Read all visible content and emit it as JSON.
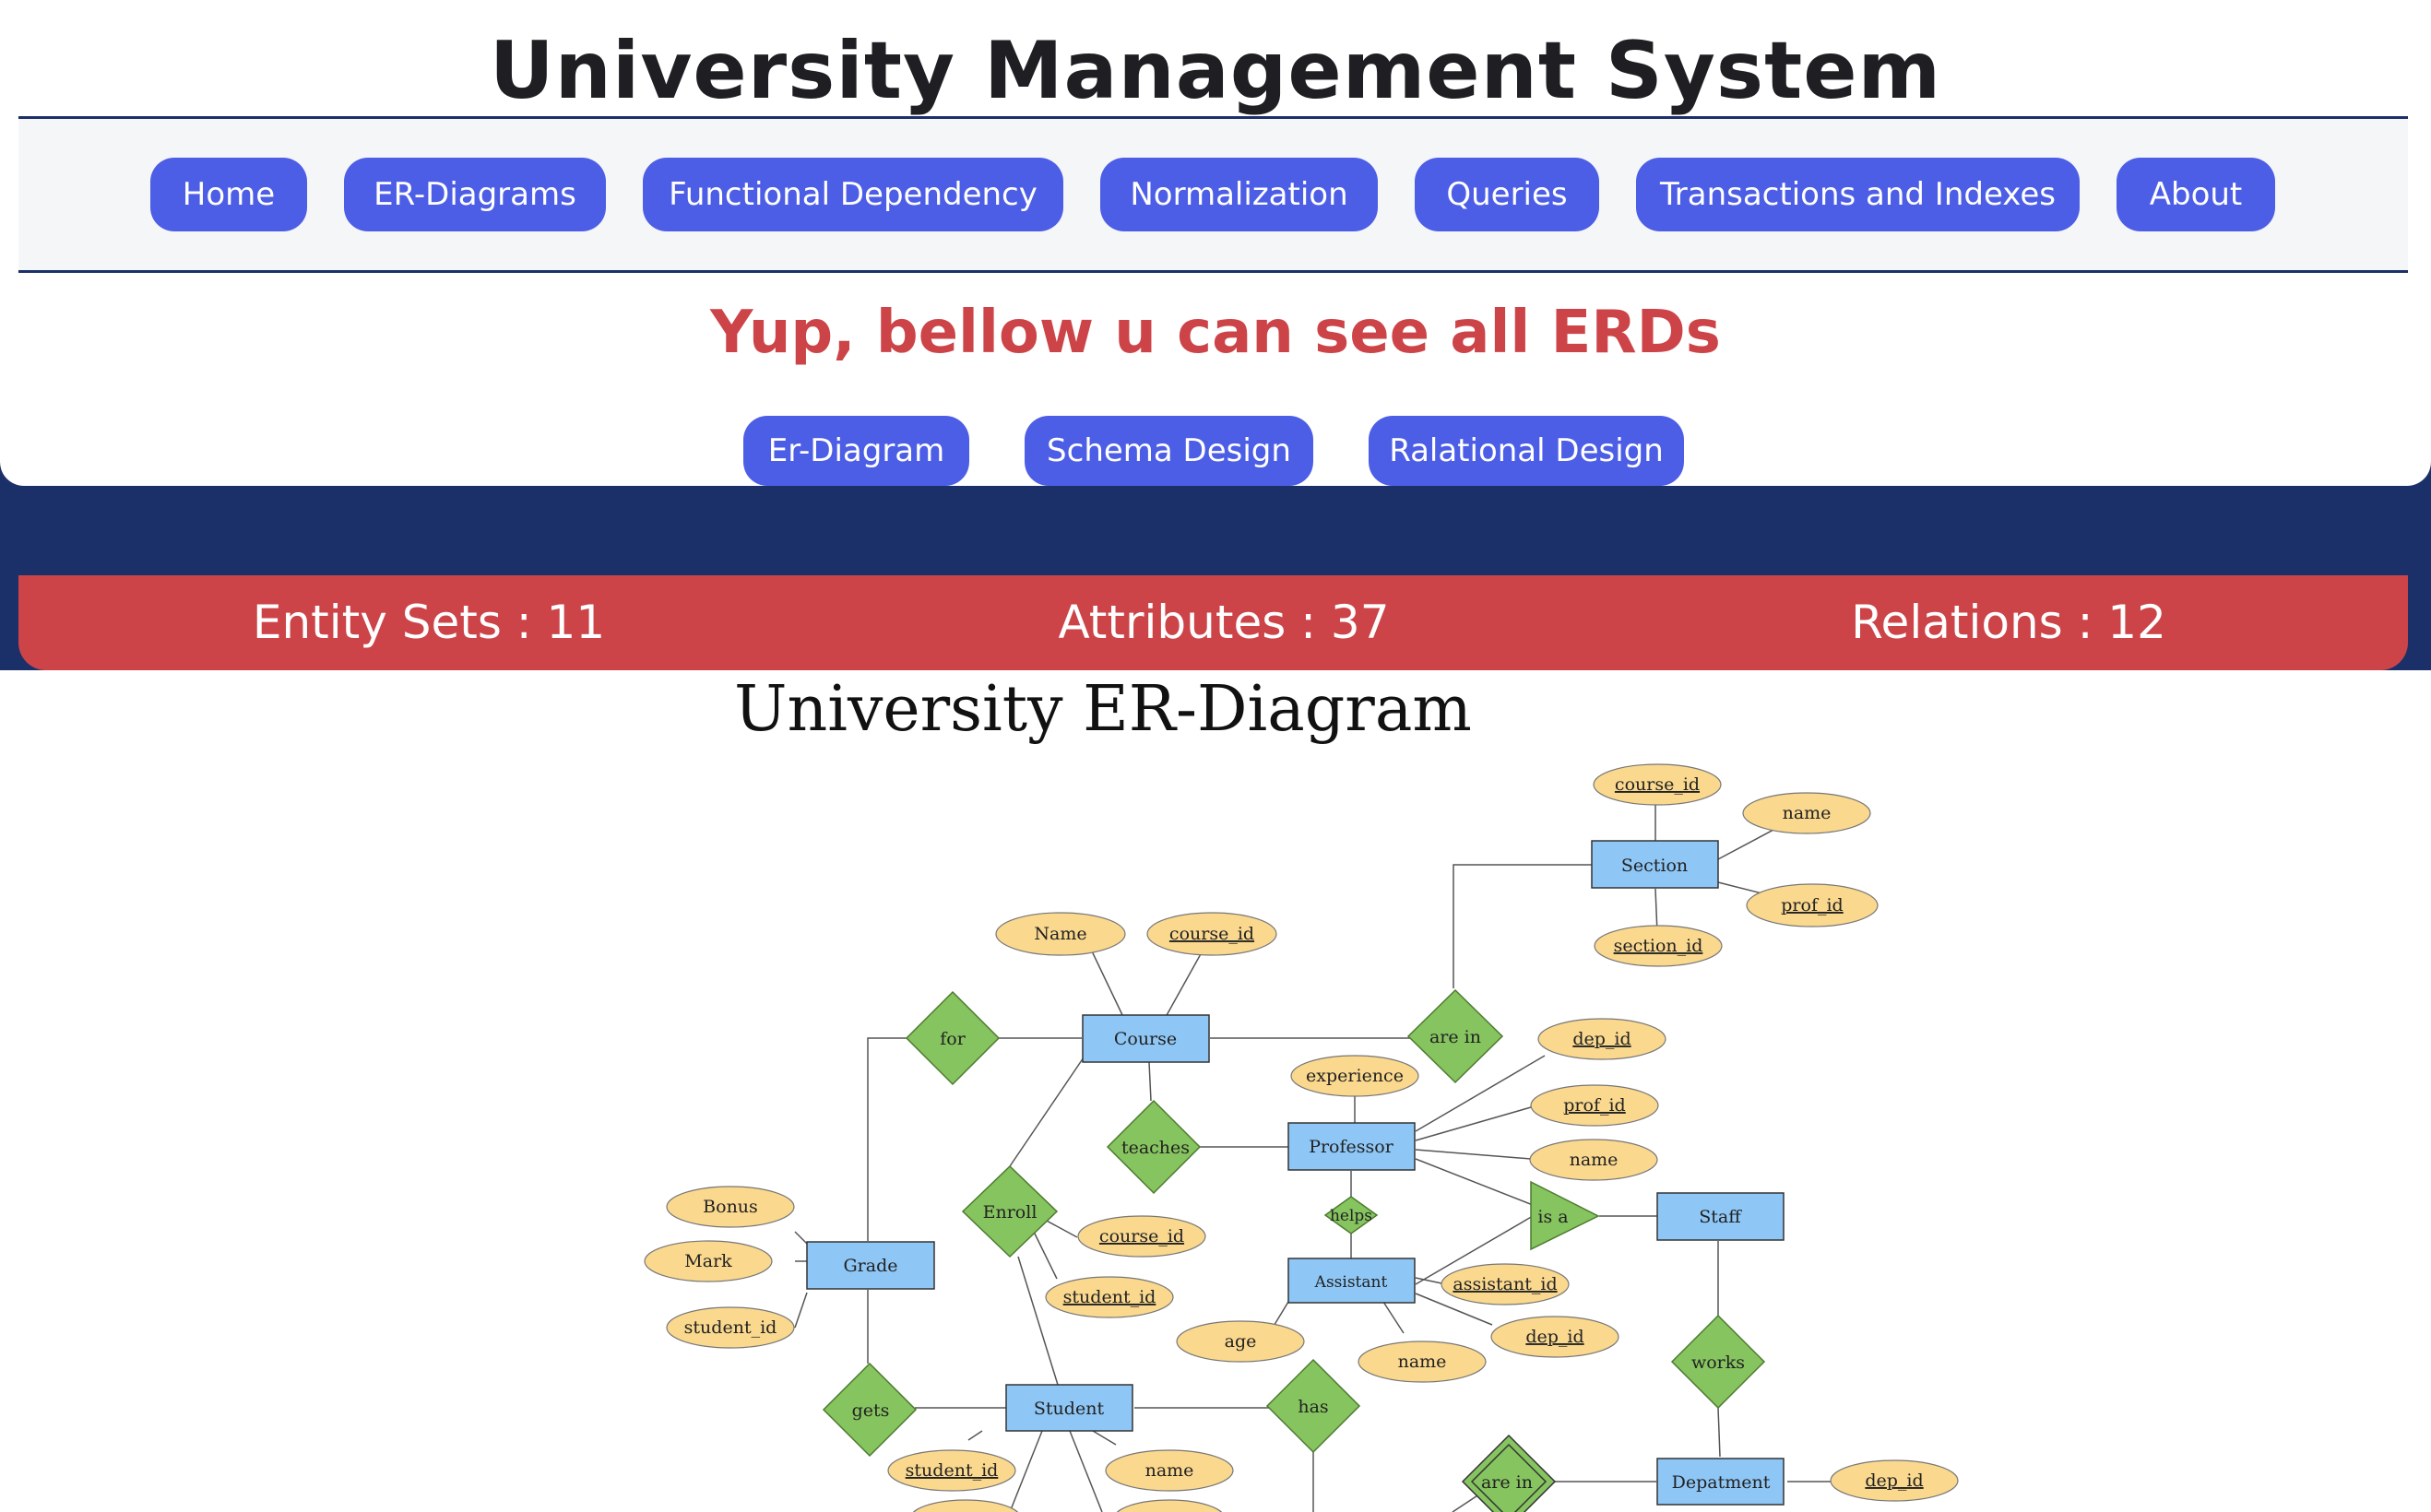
{
  "header": {
    "title": "University Management System"
  },
  "nav": {
    "items": [
      {
        "label": "Home",
        "name": "nav-home"
      },
      {
        "label": "ER-Diagrams",
        "name": "nav-er-diagrams"
      },
      {
        "label": "Functional Dependency",
        "name": "nav-functional-dependency"
      },
      {
        "label": "Normalization",
        "name": "nav-normalization"
      },
      {
        "label": "Queries",
        "name": "nav-queries"
      },
      {
        "label": "Transactions and Indexes",
        "name": "nav-transactions-indexes"
      },
      {
        "label": "About",
        "name": "nav-about"
      }
    ]
  },
  "subtitle": "Yup, bellow u can see all ERDs",
  "subnav": {
    "items": [
      {
        "label": "Er-Diagram",
        "name": "subnav-er-diagram"
      },
      {
        "label": "Schema Design",
        "name": "subnav-schema-design"
      },
      {
        "label": "Ralational Design",
        "name": "subnav-relational-design"
      }
    ]
  },
  "stats": {
    "entity_sets": "Entity Sets : 11",
    "attributes": "Attributes : 37",
    "relations": "Relations : 12"
  },
  "colors": {
    "accent": "#4d5ee6",
    "brand_dark": "#1b3068",
    "red": "#cc4448",
    "entity": "#8ec6f5",
    "attribute": "#fad88e",
    "relationship": "#86c460"
  },
  "diagram": {
    "title": "University ER-Diagram",
    "entities": {
      "section": "Section",
      "course": "Course",
      "professor": "Professor",
      "staff": "Staff",
      "grade": "Grade",
      "assistant": "Assistant",
      "student": "Student",
      "department": "Depatment"
    },
    "relationships": {
      "for": "for",
      "are_in_1": "are in",
      "teaches": "teaches",
      "helps": "helps",
      "is_a": "is a",
      "enroll": "Enroll",
      "works": "works",
      "gets": "gets",
      "has": "has",
      "are_in_2": "are in"
    },
    "attributes": {
      "section_course_id": "course_id",
      "section_name": "name",
      "section_prof_id": "prof_id",
      "section_section_id": "section_id",
      "course_name": "Name",
      "course_course_id": "course_id",
      "prof_dep_id": "dep_id",
      "prof_experience": "experience",
      "prof_prof_id": "prof_id",
      "prof_name": "name",
      "grade_bonus": "Bonus",
      "grade_mark": "Mark",
      "grade_student_id": "student_id",
      "enroll_course_id": "course_id",
      "enroll_student_id": "student_id",
      "assistant_assistant_id": "assistant_id",
      "assistant_dep_id": "dep_id",
      "assistant_age": "age",
      "assistant_name": "name",
      "student_student_id": "student_id",
      "student_name": "name",
      "dept_dep_id": "dep_id"
    }
  }
}
